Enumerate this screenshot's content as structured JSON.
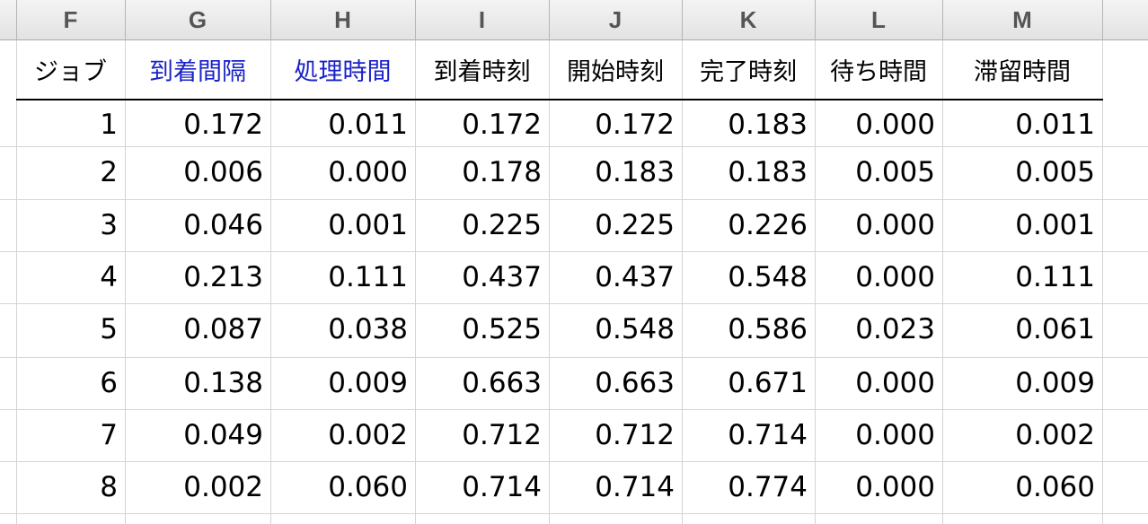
{
  "column_letters": [
    "F",
    "G",
    "H",
    "I",
    "J",
    "K",
    "L",
    "M"
  ],
  "header_labels": [
    "ジョブ",
    "到着間隔",
    "処理時間",
    "到着時刻",
    "開始時刻",
    "完了時刻",
    "待ち時間",
    "滞留時間"
  ],
  "header_colors": [
    "#000000",
    "#1a22c8",
    "#1a22c8",
    "#000000",
    "#000000",
    "#000000",
    "#000000",
    "#000000"
  ],
  "rows": [
    [
      "1",
      "0.172",
      "0.011",
      "0.172",
      "0.172",
      "0.183",
      "0.000",
      "0.011"
    ],
    [
      "2",
      "0.006",
      "0.000",
      "0.178",
      "0.183",
      "0.183",
      "0.005",
      "0.005"
    ],
    [
      "3",
      "0.046",
      "0.001",
      "0.225",
      "0.225",
      "0.226",
      "0.000",
      "0.001"
    ],
    [
      "4",
      "0.213",
      "0.111",
      "0.437",
      "0.437",
      "0.548",
      "0.000",
      "0.111"
    ],
    [
      "5",
      "0.087",
      "0.038",
      "0.525",
      "0.548",
      "0.586",
      "0.023",
      "0.061"
    ],
    [
      "6",
      "0.138",
      "0.009",
      "0.663",
      "0.663",
      "0.671",
      "0.000",
      "0.009"
    ],
    [
      "7",
      "0.049",
      "0.002",
      "0.712",
      "0.712",
      "0.714",
      "0.000",
      "0.002"
    ],
    [
      "8",
      "0.002",
      "0.060",
      "0.714",
      "0.714",
      "0.774",
      "0.000",
      "0.060"
    ]
  ]
}
